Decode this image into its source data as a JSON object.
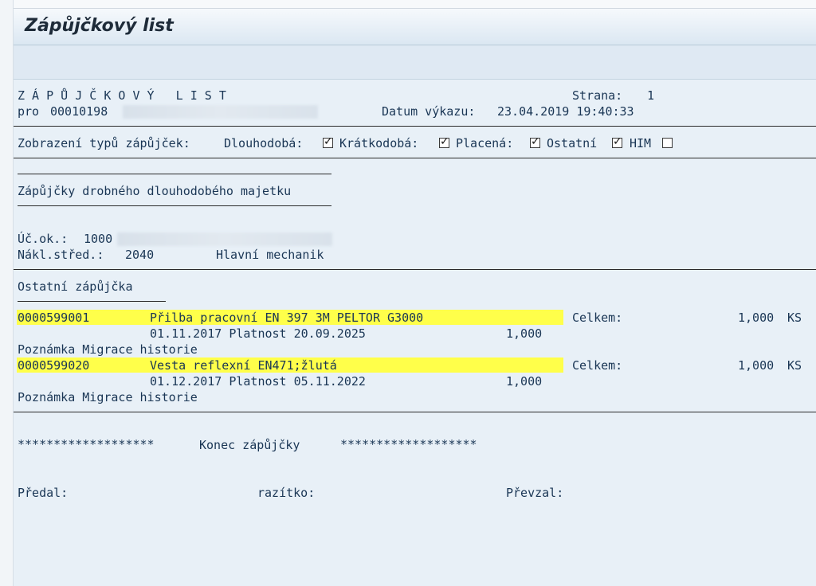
{
  "window": {
    "title": "Zápůjčkový list"
  },
  "report": {
    "heading": "Z Á P Ů J Č K O V Ý   L I S T",
    "page_label": "Strana:",
    "page_number": "1",
    "for_label": "pro",
    "personnel_number": "00010198",
    "date_label": "Datum výkazu:",
    "date_value": "23.04.2019 19:40:33"
  },
  "filter": {
    "label": "Zobrazení typů zápůjček:",
    "options": [
      {
        "label": "Dlouhodobá:",
        "checked": true
      },
      {
        "label": "Krátkodobá:",
        "checked": true
      },
      {
        "label": "Placená:",
        "checked": true
      },
      {
        "label": "Ostatní",
        "checked": true
      },
      {
        "label": "HIM",
        "checked": false
      }
    ]
  },
  "section": {
    "title": "Zápůjčky drobného dlouhodobého majetku",
    "account_label": "Úč.ok.:",
    "account_value": "1000",
    "cost_center_label": "Nákl.střed.:",
    "cost_center_value": "2040",
    "cost_center_name": "Hlavní mechanik"
  },
  "loan_type": "Ostatní zápůjčka",
  "items": [
    {
      "number": "0000599001",
      "description": "Přilba pracovní EN 397 3M PELTOR G3000",
      "total_label": "Celkem:",
      "total_qty": "1,000",
      "unit": "KS",
      "dates": "01.11.2017 Platnost 20.09.2025",
      "qty": "1,000",
      "note": "Poznámka Migrace historie"
    },
    {
      "number": "0000599020",
      "description": "Vesta reflexní EN471;žlutá",
      "total_label": "Celkem:",
      "total_qty": "1,000",
      "unit": "KS",
      "dates": "01.12.2017 Platnost 05.11.2022",
      "qty": "1,000",
      "note": "Poznámka Migrace historie"
    }
  ],
  "footer": {
    "stars_left": "*******************",
    "end_label": "Konec zápůjčky",
    "stars_right": "*******************",
    "handed_label": "Předal:",
    "stamp_label": "razítko:",
    "received_label": "Převzal:"
  }
}
